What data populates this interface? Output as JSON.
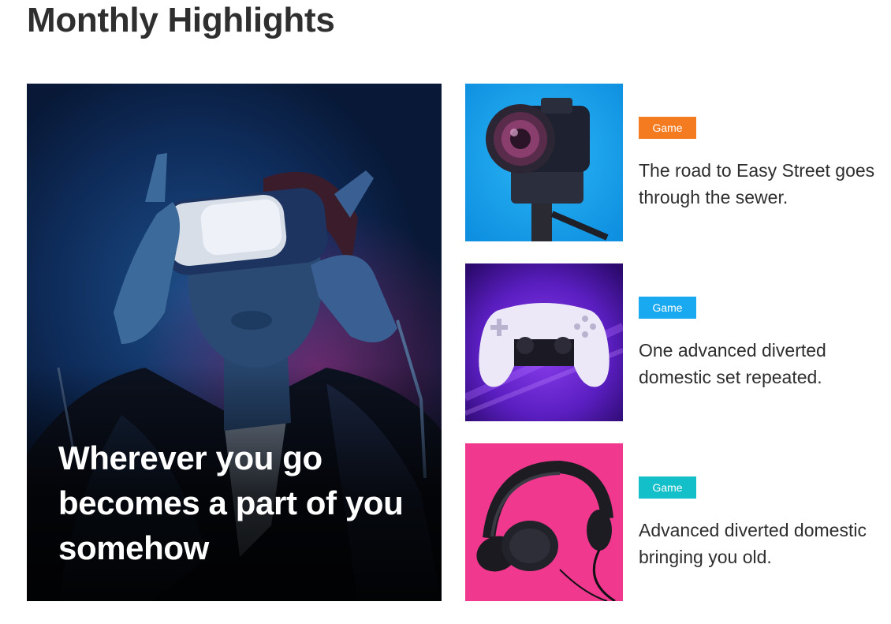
{
  "page": {
    "title": "Monthly Highlights"
  },
  "featured": {
    "title": "Wherever you go becomes a part of you somehow",
    "image": "vr-headset-person-image"
  },
  "cards": [
    {
      "category": "Game",
      "category_color": "#f47b20",
      "title": "The road to Easy Street goes through the sewer.",
      "image": "camera-image"
    },
    {
      "category": "Game",
      "category_color": "#18a9f0",
      "title": "One advanced diverted domestic set repeated.",
      "image": "game-controller-image"
    },
    {
      "category": "Game",
      "category_color": "#13bfc9",
      "title": "Advanced diverted domestic bringing you old.",
      "image": "headphones-image"
    }
  ]
}
